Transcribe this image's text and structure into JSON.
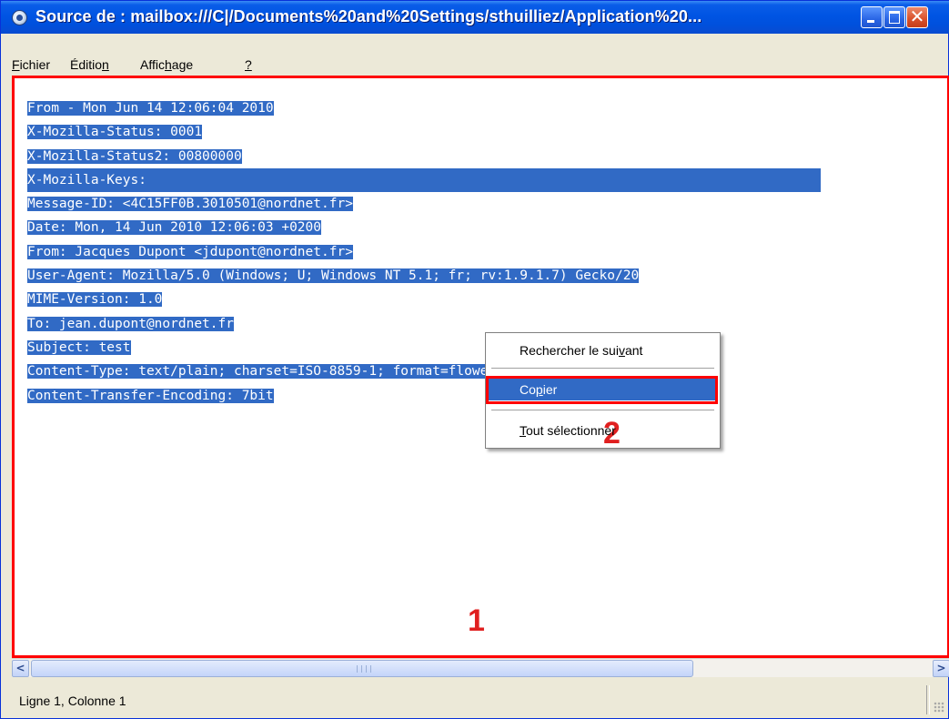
{
  "window": {
    "title": "Source de : mailbox:///C|/Documents%20and%20Settings/sthuilliez/Application%20...",
    "icon": "seamonkey-globe-icon",
    "controls": {
      "minimize": "minimize-icon",
      "maximize": "maximize-icon",
      "close": "✕"
    }
  },
  "menu": {
    "items": [
      {
        "pre": "",
        "key": "F",
        "post": "ichier"
      },
      {
        "pre": "Éditio",
        "key": "n",
        "post": ""
      },
      {
        "pre": "Affic",
        "key": "h",
        "post": "age"
      },
      {
        "pre": "",
        "key": "?",
        "post": ""
      }
    ]
  },
  "source": {
    "lines": [
      "From - Mon Jun 14 12:06:04 2010",
      "X-Mozilla-Status: 0001",
      "X-Mozilla-Status2: 00800000",
      "X-Mozilla-Keys:",
      "Message-ID: <4C15FF0B.3010501@nordnet.fr>",
      "Date: Mon, 14 Jun 2010 12:06:03 +0200",
      "From: Jacques Dupont <jdupont@nordnet.fr>",
      "User-Agent: Mozilla/5.0 (Windows; U; Windows NT 5.1; fr; rv:1.9.1.7) Gecko/20",
      "MIME-Version: 1.0",
      "To: jean.dupont@nordnet.fr",
      "Subject: test",
      "Content-Type: text/plain; charset=ISO-8859-1; format=flowed",
      "Content-Transfer-Encoding: 7bit"
    ],
    "selection_color": "#316ac5"
  },
  "annotations": {
    "area_marker": "1",
    "copy_marker": "2",
    "color": "#ff0000"
  },
  "context_menu": {
    "find_next": {
      "pre": "Rechercher le sui",
      "key": "v",
      "post": "ant"
    },
    "copy": {
      "pre": "Co",
      "key": "p",
      "post": "ier"
    },
    "select_all": {
      "pre": "",
      "key": "T",
      "post": "out sélectionner"
    }
  },
  "scrollbar": {
    "left": "<",
    "right": ">"
  },
  "status": {
    "text": "Ligne 1, Colonne 1"
  }
}
